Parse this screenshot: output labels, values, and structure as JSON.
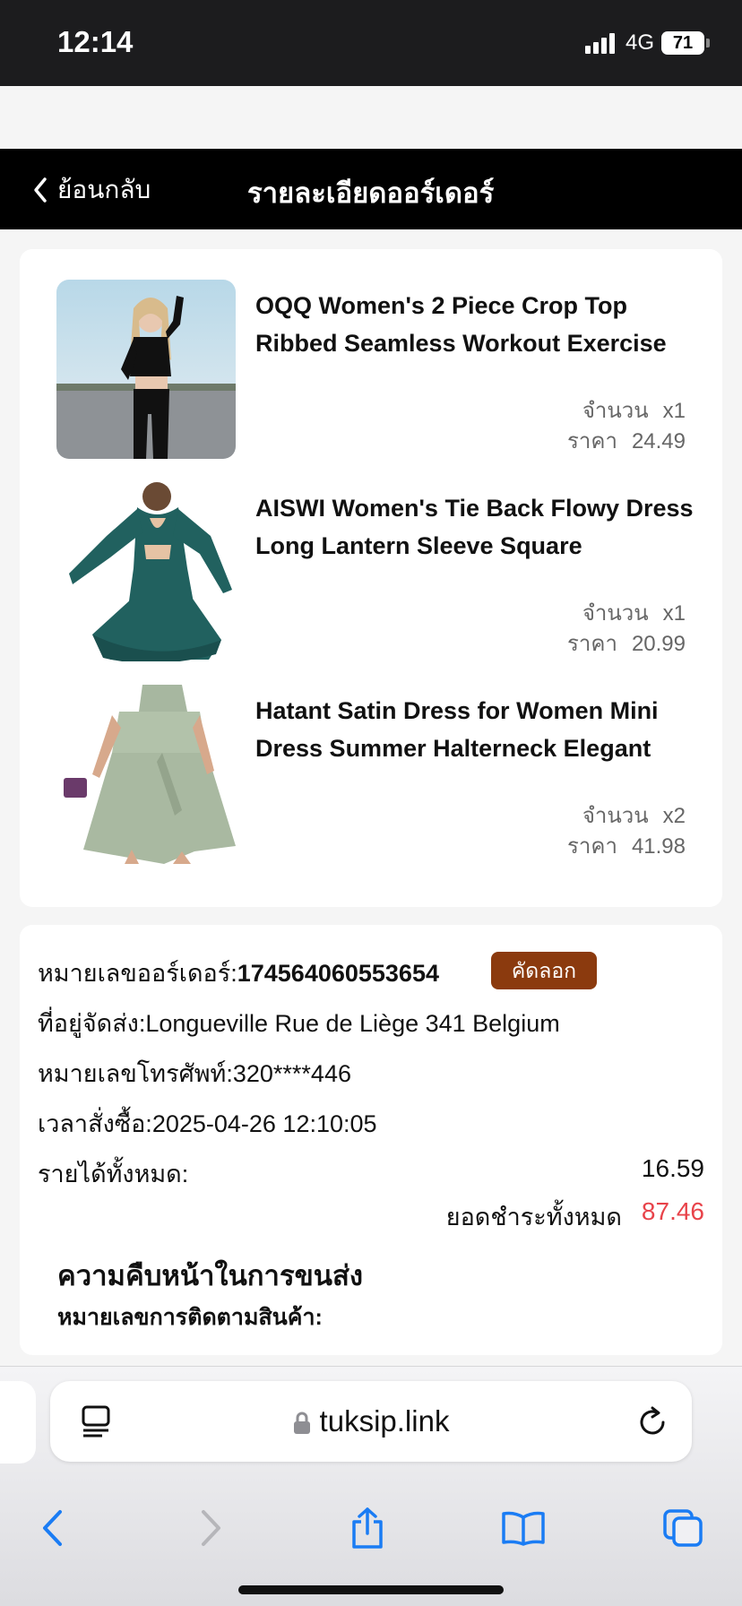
{
  "status_bar": {
    "time": "12:14",
    "network": "4G",
    "battery": "71"
  },
  "header": {
    "back_label": "ย้อนกลับ",
    "title": "รายละเอียดออร์เดอร์"
  },
  "items": [
    {
      "name": "OQQ Women's 2 Piece Crop Top Ribbed Seamless Workout Exercise",
      "qty_label": "จำนวน",
      "qty": "x1",
      "price_label": "ราคา",
      "price": "24.49"
    },
    {
      "name": "AISWI Women's Tie Back Flowy Dress Long Lantern Sleeve Square",
      "qty_label": "จำนวน",
      "qty": "x1",
      "price_label": "ราคา",
      "price": "20.99"
    },
    {
      "name": "Hatant Satin Dress for Women Mini Dress Summer Halterneck Elegant",
      "qty_label": "จำนวน",
      "qty": "x2",
      "price_label": "ราคา",
      "price": "41.98"
    }
  ],
  "order": {
    "order_no_label": "หมายเลขออร์เดอร์:",
    "order_no": "174564060553654",
    "copy_label": "คัดลอก",
    "address_label": "ที่อยู่จัดส่ง:",
    "address": "Longueville Rue de Liège 341 Belgium",
    "phone_label": "หมายเลขโทรศัพท์:",
    "phone": "320****446",
    "time_label": "เวลาสั่งซื้อ:",
    "time": "2025-04-26 12:10:05",
    "income_label": "รายได้ทั้งหมด:",
    "income": "16.59",
    "total_label": "ยอดชำระทั้งหมด",
    "total": "87.46",
    "total_color": "#e8434a",
    "progress_title": "ความคืบหน้าในการขนส่ง",
    "tracking_label": "หมายเลขการติดตามสินค้า:"
  },
  "browser": {
    "url": "tuksip.link"
  },
  "colors": {
    "accent": "#8b3a0e",
    "toolbar_blue": "#1a7cf4"
  }
}
